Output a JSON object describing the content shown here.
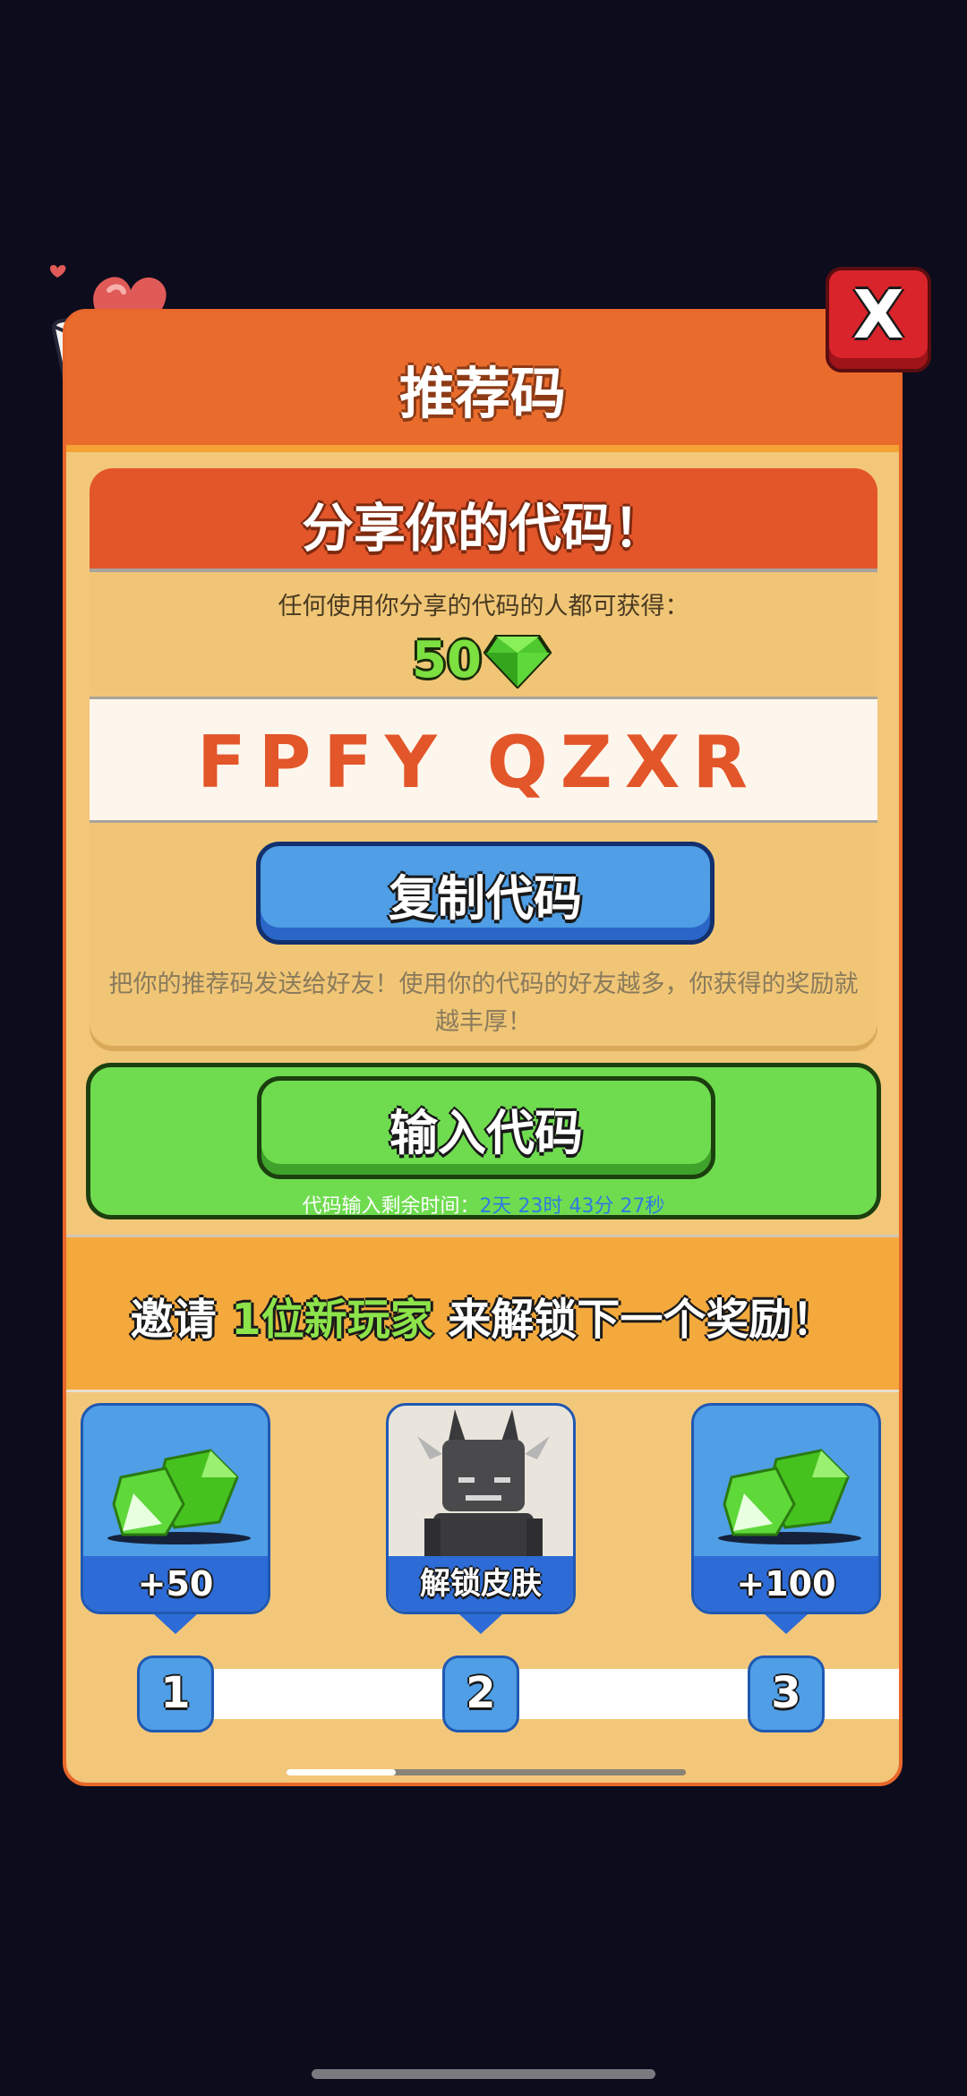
{
  "header": {
    "title": "推荐码"
  },
  "close_button": {
    "label": "X"
  },
  "share": {
    "title": "分享你的代码！",
    "reward_desc": "任何使用你分享的代码的人都可获得：",
    "reward_amount": "50",
    "code": "FPFY QZXR",
    "copy_label": "复制代码",
    "note": "把你的推荐码发送给好友！使用你的代码的好友越多，你获得的奖励就越丰厚！"
  },
  "enter": {
    "button_label": "输入代码",
    "timer_prefix": "代码输入剩余时间：",
    "days": "2",
    "days_unit": "天",
    "hours": "23",
    "hours_unit": "时",
    "minutes": "43",
    "minutes_unit": "分",
    "seconds": "27",
    "seconds_unit": "秒"
  },
  "invite": {
    "part1": "邀请 ",
    "highlight": "1位新玩家",
    "part2": " 来解锁下一个奖励！"
  },
  "rewards": [
    {
      "label": "+50",
      "icon": "gem-icon"
    },
    {
      "label": "解锁皮肤",
      "icon": "skin-character-icon"
    },
    {
      "label": "+100",
      "icon": "gem-icon"
    }
  ],
  "steps": [
    "1",
    "2",
    "3"
  ],
  "colors": {
    "orange": "#e96c2d",
    "blue": "#4f9ee6",
    "green": "#6fdc4f",
    "red": "#d9242b"
  }
}
